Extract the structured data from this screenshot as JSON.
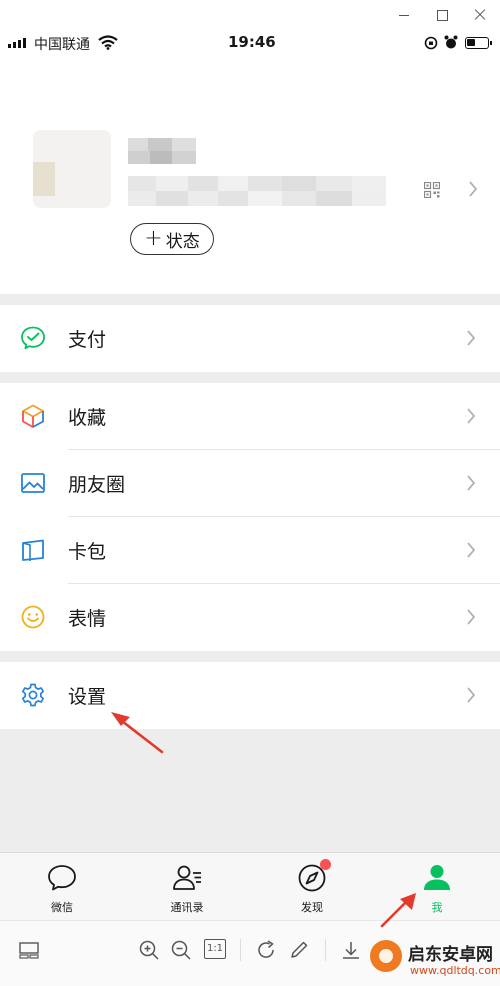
{
  "status_bar": {
    "carrier": "中国联通",
    "time": "19:46"
  },
  "profile": {
    "status_button_label": "状态"
  },
  "menu": {
    "pay": "支付",
    "favorites": "收藏",
    "moments": "朋友圈",
    "cards": "卡包",
    "stickers": "表情",
    "settings": "设置"
  },
  "tabbar": {
    "tabs": [
      {
        "label": "微信",
        "icon": "chat-bubble-icon"
      },
      {
        "label": "通讯录",
        "icon": "contacts-icon"
      },
      {
        "label": "发现",
        "icon": "compass-icon",
        "badge": true
      },
      {
        "label": "我",
        "icon": "person-icon",
        "active": true
      }
    ]
  },
  "viewer_toolbar": {
    "one_to_one_label": "1:1"
  },
  "watermark": {
    "title": "启东安卓网",
    "url": "www.qdltdq.com"
  },
  "colors": {
    "accent_green": "#07c160",
    "background_grey": "#ededed",
    "annotation_red": "#e23b2e",
    "badge_red": "#fa5151"
  }
}
